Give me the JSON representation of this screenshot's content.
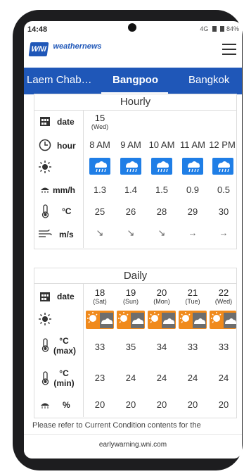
{
  "status": {
    "time": "14:48",
    "network": "4G",
    "battery": "84%"
  },
  "app": {
    "logo_mark": "WNI",
    "logo_text": "weathernews"
  },
  "tabs": [
    {
      "label": "Laem Chab…",
      "active": false
    },
    {
      "label": "Bangpoo",
      "active": true
    },
    {
      "label": "Bangkok",
      "active": false
    }
  ],
  "hourly": {
    "title": "Hourly",
    "labels": {
      "date": "date",
      "hour": "hour",
      "mmh": "mm/h",
      "temp": "°C",
      "wind": "m/s"
    },
    "date": {
      "day": "15",
      "weekday": "(Wed)"
    },
    "hours": [
      "8 AM",
      "9 AM",
      "10 AM",
      "11 AM",
      "12 PM"
    ],
    "precip": [
      "1.3",
      "1.4",
      "1.5",
      "0.9",
      "0.5"
    ],
    "temps": [
      "25",
      "26",
      "28",
      "29",
      "30"
    ],
    "wind_arrows": [
      "↘",
      "↘",
      "↘",
      "→",
      "→"
    ],
    "weather_icon": "rain-cloud-icon"
  },
  "daily": {
    "title": "Daily",
    "labels": {
      "date": "date",
      "max_unit": "°C",
      "max": "(max)",
      "min_unit": "°C",
      "min": "(min)",
      "pct": "%"
    },
    "days": [
      {
        "day": "18",
        "weekday": "(Sat)"
      },
      {
        "day": "19",
        "weekday": "(Sun)"
      },
      {
        "day": "20",
        "weekday": "(Mon)"
      },
      {
        "day": "21",
        "weekday": "(Tue)"
      },
      {
        "day": "22",
        "weekday": "(Wed)"
      }
    ],
    "max": [
      "33",
      "35",
      "34",
      "33",
      "33"
    ],
    "min": [
      "23",
      "24",
      "24",
      "24",
      "24"
    ],
    "pct": [
      "20",
      "20",
      "20",
      "20",
      "20"
    ],
    "weather_icon": "sun-cloud-icon"
  },
  "note": "Please refer to Current Condition contents for the",
  "footer": "earlywarning.wni.com",
  "colors": {
    "brand_blue": "#1f57b8",
    "rain_blue": "#1f7ee6",
    "sun_orange": "#f08a1c"
  }
}
